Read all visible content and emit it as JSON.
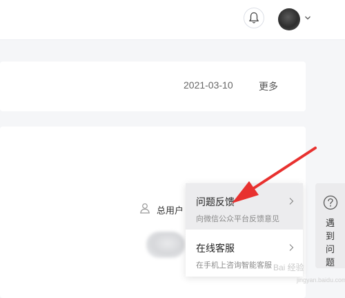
{
  "header": {
    "bell_icon": "bell-icon",
    "avatar_icon": "avatar",
    "dropdown_icon": "chevron-down-icon"
  },
  "notice": {
    "date": "2021-03-10",
    "more": "更多"
  },
  "content": {
    "user_label": "总用户"
  },
  "menu": {
    "items": [
      {
        "title": "问题反馈",
        "subtitle": "向微信公众平台反馈意见"
      },
      {
        "title": "在线客服",
        "subtitle": "在手机上咨询智能客服"
      }
    ]
  },
  "side_tab": {
    "icon": "question-circle-icon",
    "chars": [
      "遇",
      "到",
      "问",
      "题"
    ]
  },
  "annotation": {
    "arrow_color": "#e8312f"
  },
  "watermark": {
    "text": "Bai 经验",
    "url": "jingyan.baidu.com"
  },
  "colors": {
    "background": "#f5f6f8",
    "menu_highlight": "#ececee"
  }
}
